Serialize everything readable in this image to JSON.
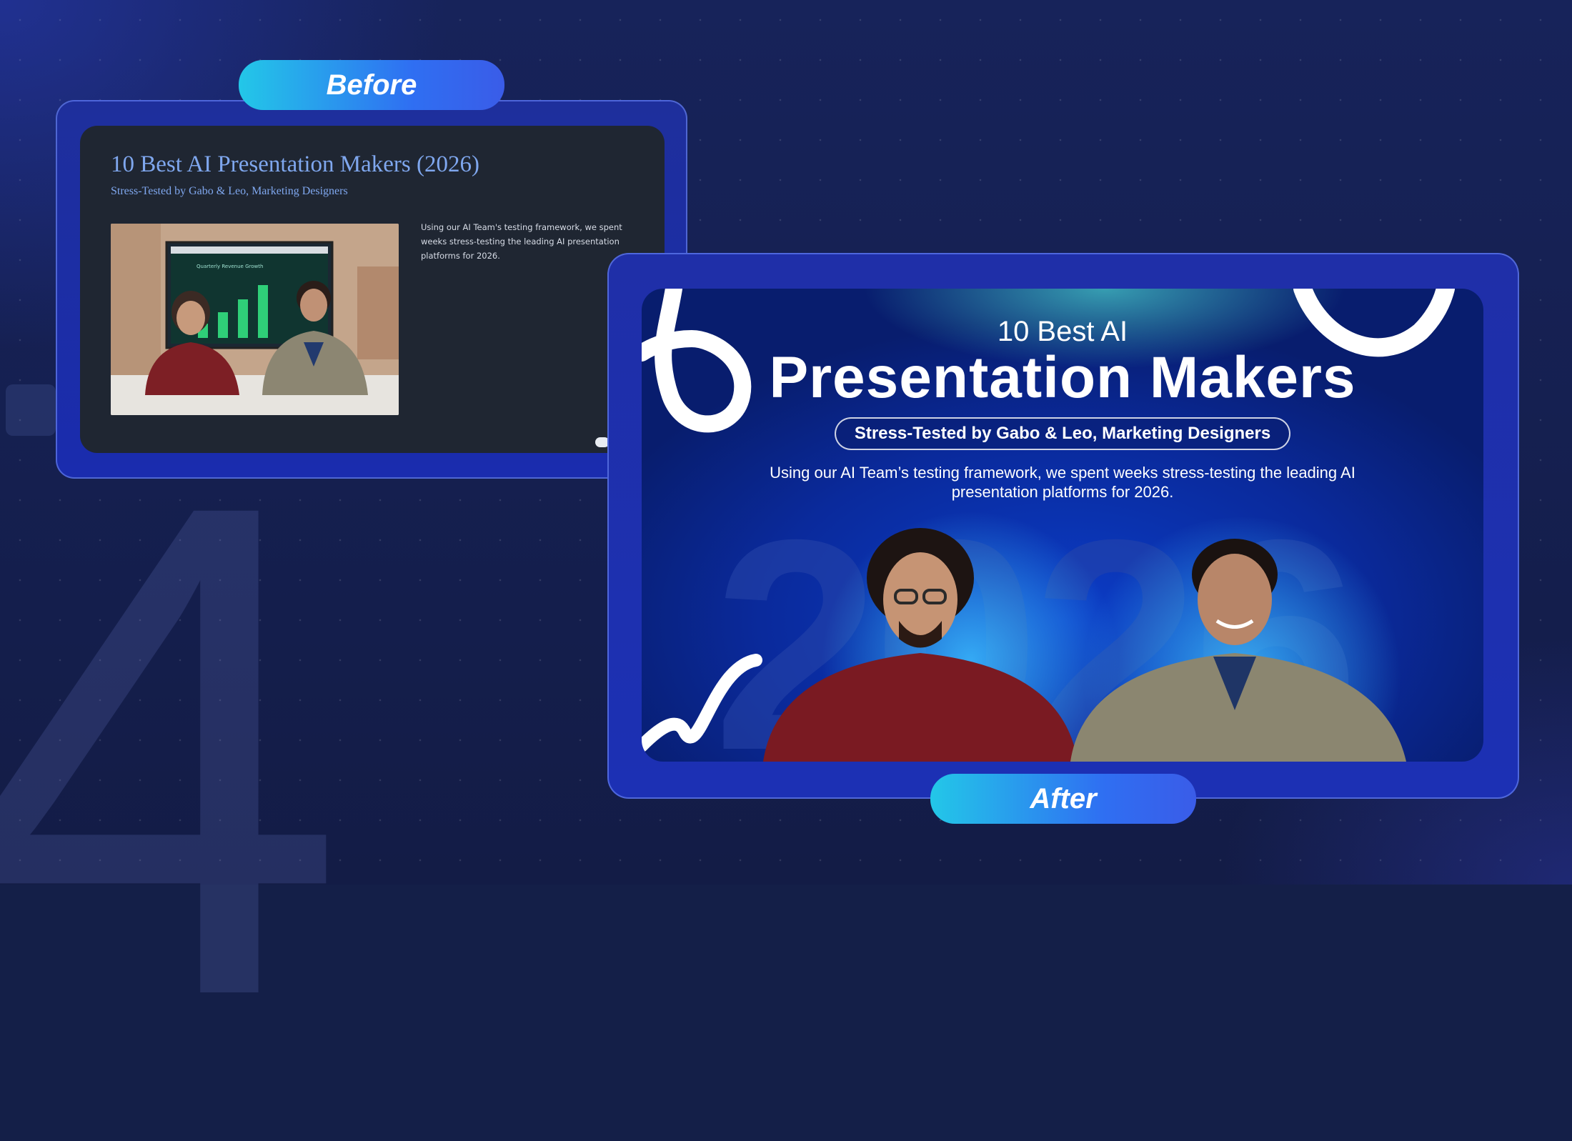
{
  "before": {
    "label": "Before",
    "title": "10 Best AI Presentation Makers (2026)",
    "subtitle": "Stress-Tested by Gabo & Leo, Marketing Designers",
    "body": "Using our AI Team's testing framework, we spent weeks stress-testing the leading AI presentation platforms for 2026.",
    "photo_screen_caption": "Quarterly Revenue Growth"
  },
  "after": {
    "label": "After",
    "title_small": "10 Best AI",
    "title_large": "Presentation Makers",
    "badge": "Stress-Tested by Gabo & Leo, Marketing Designers",
    "body": "Using our AI Team’s testing framework, we spent weeks stress-testing the leading AI presentation platforms for 2026.",
    "background_year": "2026"
  },
  "background": {
    "digit": "4"
  },
  "colors": {
    "accent_cyan": "#23c7e8",
    "accent_blue": "#2f6ff2",
    "before_text": "#7fa7ee",
    "page_bg": "#141f48"
  }
}
